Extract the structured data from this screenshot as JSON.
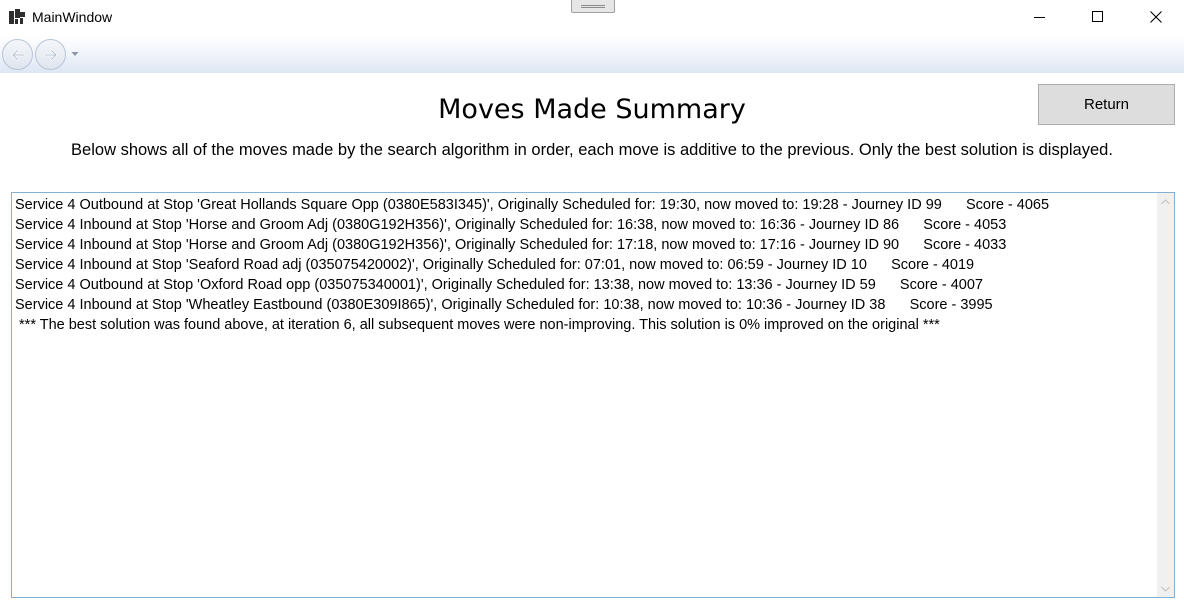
{
  "window": {
    "title": "MainWindow",
    "app_icon": "app-icon",
    "controls": [
      "minimize-icon",
      "maximize-icon",
      "close-icon"
    ]
  },
  "navigation": {
    "back_icon": "back-arrow-icon",
    "forward_icon": "forward-arrow-icon",
    "history_icon": "chevron-down-icon"
  },
  "page": {
    "title": "Moves Made Summary",
    "subtitle": "Below shows all of the moves made by the search algorithm in order, each move is additive to the previous. Only the best solution is displayed.",
    "return_label": "Return"
  },
  "moves": [
    "Service 4 Outbound at Stop 'Great Hollands Square Opp (0380E583I345)', Originally Scheduled for: 19:30, now moved to: 19:28 - Journey ID 99      Score - 4065",
    "Service 4 Inbound at Stop 'Horse and Groom Adj (0380G192H356)', Originally Scheduled for: 16:38, now moved to: 16:36 - Journey ID 86      Score - 4053",
    "Service 4 Inbound at Stop 'Horse and Groom Adj (0380G192H356)', Originally Scheduled for: 17:18, now moved to: 17:16 - Journey ID 90      Score - 4033",
    "Service 4 Inbound at Stop 'Seaford Road adj (035075420002)', Originally Scheduled for: 07:01, now moved to: 06:59 - Journey ID 10      Score - 4019",
    "Service 4 Outbound at Stop 'Oxford Road opp (035075340001)', Originally Scheduled for: 13:38, now moved to: 13:36 - Journey ID 59      Score - 4007",
    "Service 4 Inbound at Stop 'Wheatley Eastbound (0380E309I865)', Originally Scheduled for: 10:38, now moved to: 10:36 - Journey ID 38      Score - 3995",
    " *** The best solution was found above, at iteration 6, all subsequent moves were non-improving. This solution is 0% improved on the original ***"
  ]
}
